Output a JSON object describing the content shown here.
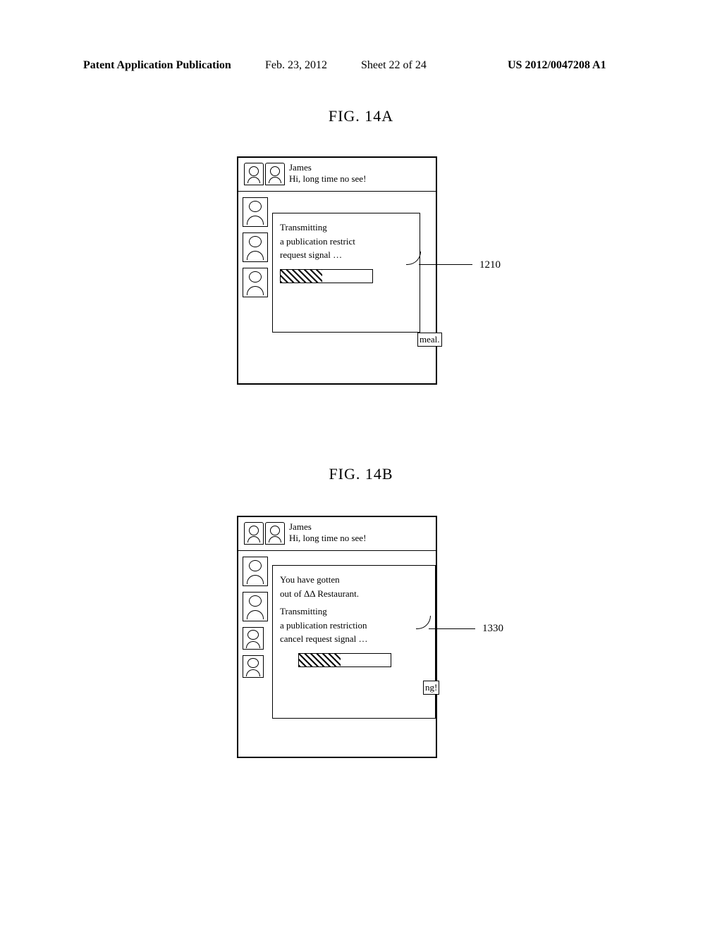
{
  "header": {
    "pub_type": "Patent Application Publication",
    "date": "Feb. 23, 2012",
    "sheet": "Sheet 22 of 24",
    "pub_number": "US 2012/0047208 A1"
  },
  "figure_a": {
    "label": "FIG. 14A",
    "callout_ref": "1210",
    "post": {
      "name": "James",
      "text": "Hi, long time no see!"
    },
    "popup_lines": {
      "l1": "Transmitting",
      "l2": "a publication restrict",
      "l3": "request signal …"
    },
    "peek_text": "meal."
  },
  "figure_b": {
    "label": "FIG. 14B",
    "callout_ref": "1330",
    "post": {
      "name": "James",
      "text": "Hi, long time no see!"
    },
    "popup_lines": {
      "l1": "You have gotten",
      "l2": "out of ΔΔ Restaurant.",
      "l3": "Transmitting",
      "l4": "a publication restriction",
      "l5": "cancel request signal …"
    },
    "peek_text": "ng!"
  }
}
